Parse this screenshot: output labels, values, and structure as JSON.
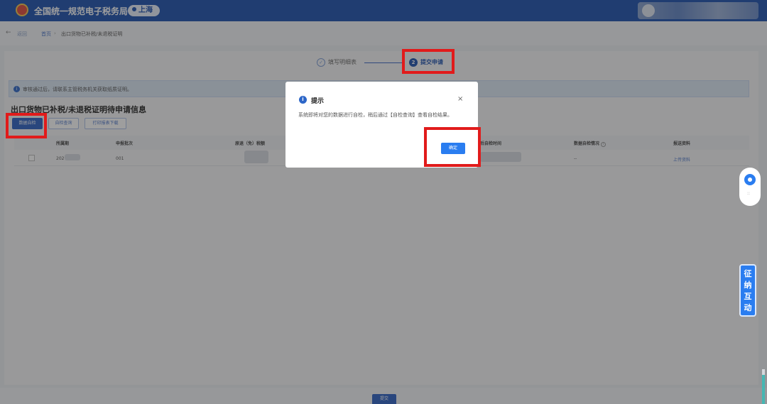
{
  "header": {
    "app_title": "全国统一规范电子税务局",
    "region": "上海"
  },
  "breadcrumb": {
    "back": "返回",
    "home": "首页",
    "separator": "›",
    "current": "出口货物已补税/未退税证明"
  },
  "steps": [
    {
      "label": "填写明细表",
      "state": "done",
      "icon": "check-circle-icon"
    },
    {
      "label": "提交申请",
      "state": "active",
      "number": "2"
    }
  ],
  "notice": {
    "text": "审核通过后，请联系主管税务机关获取纸质证明。"
  },
  "section_title": "出口货物已补税/未退税证明待申请信息",
  "buttons": {
    "self_check": "数据自检",
    "self_check_query": "自检查询",
    "print_report": "打印报表下载"
  },
  "table": {
    "headers": [
      "所属期",
      "申报批次",
      "原退（免）税额",
      "最后自检时间",
      "数据自检情况",
      "报送资料"
    ],
    "rows": [
      {
        "period": "202",
        "batch": "001",
        "status": "--",
        "action": "上传资料"
      }
    ]
  },
  "dialog": {
    "title": "提示",
    "message": "系统即将对您的数据进行自检，稍后通过【自检查询】查看自检结果。",
    "ok": "确定",
    "close": "×"
  },
  "floating": {
    "interact": "征纳互动",
    "dots": "::"
  },
  "footer": {
    "submit": "提交"
  },
  "colors": {
    "brand": "#1b4fae",
    "primary_button": "#2a7df0",
    "highlight": "#e11b1b"
  }
}
